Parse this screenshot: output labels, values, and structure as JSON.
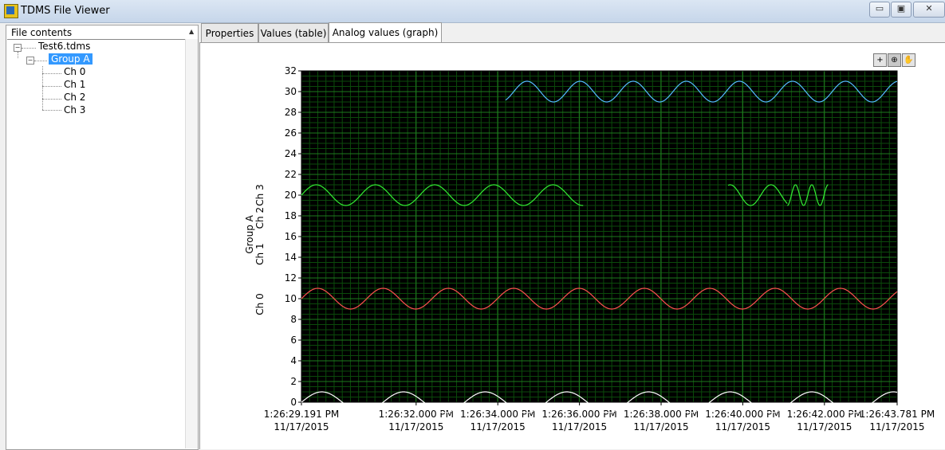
{
  "window": {
    "title": "TDMS File Viewer",
    "minimize_glyph": "▭",
    "maximize_glyph": "▣",
    "close_glyph": "✕",
    "icon": "labview-app-icon"
  },
  "tree": {
    "header": "File contents",
    "file": "Test6.tdms",
    "group": "Group A",
    "channels": [
      "Ch 0",
      "Ch 1",
      "Ch 2",
      "Ch 3"
    ],
    "expander_glyph": "−"
  },
  "tabs": [
    "Properties",
    "Values (table)",
    "Analog values (graph)"
  ],
  "active_tab": "Analog values (graph)",
  "toolbar": {
    "cursor_glyph": "+",
    "zoom_glyph": "⊕",
    "pan_glyph": "✋"
  },
  "colors": {
    "plot_background": "#000000",
    "grid_minor": "#0b4a0b",
    "grid_major": "#1e7a1e"
  },
  "chart_data": {
    "type": "line",
    "yaxis_labels": [
      "Ch 0",
      "Ch 1",
      "Group A",
      "Ch 2",
      "Ch 3"
    ],
    "ylim": [
      0,
      32
    ],
    "yticks": [
      0,
      2,
      4,
      6,
      8,
      10,
      12,
      14,
      16,
      18,
      20,
      22,
      24,
      26,
      28,
      30,
      32
    ],
    "xlim": [
      0,
      14.59
    ],
    "xtick_labels": [
      {
        "time": "1:26:29.191 PM",
        "date": "11/17/2015",
        "t": 0
      },
      {
        "time": "1:26:32.000 PM",
        "date": "11/17/2015",
        "t": 2.809
      },
      {
        "time": "1:26:34.000 PM",
        "date": "11/17/2015",
        "t": 4.809
      },
      {
        "time": "1:26:36.000 PM",
        "date": "11/17/2015",
        "t": 6.809
      },
      {
        "time": "1:26:38.000 PM",
        "date": "11/17/2015",
        "t": 8.809
      },
      {
        "time": "1:26:40.000 PM",
        "date": "11/17/2015",
        "t": 10.809
      },
      {
        "time": "1:26:42.000 PM",
        "date": "11/17/2015",
        "t": 12.809
      },
      {
        "time": "1:26:43.781 PM",
        "date": "11/17/2015",
        "t": 14.59
      }
    ],
    "grid": true,
    "series": [
      {
        "color": "#ffffff",
        "offset": 0,
        "amplitude": 1,
        "period": 2.0,
        "phase": 0,
        "t_start": 0,
        "t_end": 14.59
      },
      {
        "color": "#ff5050",
        "offset": 10,
        "amplitude": 1,
        "period": 1.6,
        "phase": 0,
        "t_start": 0,
        "t_end": 14.59
      },
      {
        "color": "#33ee33",
        "offset": 20,
        "amplitude": 1,
        "period": 1.45,
        "phase": 0,
        "t_start": 0,
        "t_end": 6.9
      },
      {
        "color": "#33ee33",
        "offset": 20,
        "amplitude": 1,
        "period": 1.0,
        "phase": 0.75,
        "t_start": 10.45,
        "t_end": 11.9
      },
      {
        "color": "#33ee33",
        "offset": 20,
        "amplitude": 1,
        "period": 0.4,
        "phase": 0,
        "t_start": 11.9,
        "t_end": 12.9
      },
      {
        "color": "#55bbff",
        "offset": 30,
        "amplitude": 1,
        "period": 1.3,
        "phase": 0.0,
        "t_start": 5.0,
        "t_end": 14.59
      }
    ]
  }
}
